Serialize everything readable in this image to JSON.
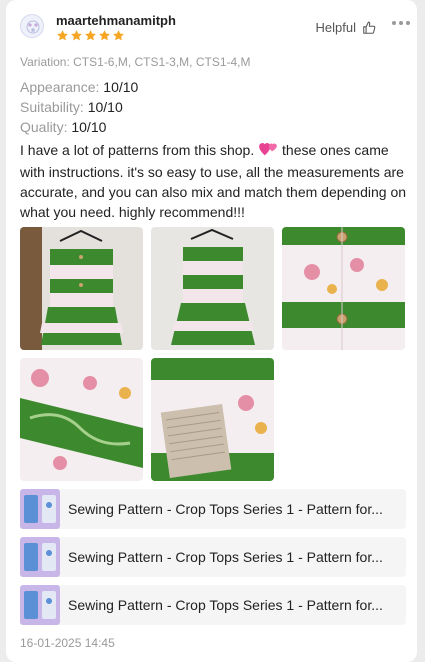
{
  "review": {
    "username": "maartehmanamitph",
    "rating_stars": 5,
    "helpful_label": "Helpful",
    "variation": "Variation: CTS1-6,M, CTS1-3,M, CTS1-4,M",
    "metrics": [
      {
        "name": "Appearance:",
        "value": "10/10"
      },
      {
        "name": "Suitability:",
        "value": "10/10"
      },
      {
        "name": "Quality:",
        "value": "10/10"
      }
    ],
    "text_part1": "I have a lot of patterns from this shop.",
    "text_part2": "these ones came with instructions. it's so easy to use, all the measurements are accurate, and you can also mix and match them depending on what you need. highly recommend!!!",
    "date": "16-01-2025 14:45"
  },
  "photos": [
    {
      "label": "photo-top-hanger-front"
    },
    {
      "label": "photo-top-hanger-back"
    },
    {
      "label": "photo-fabric-closeup-buttons"
    },
    {
      "label": "photo-fabric-closeup-pattern"
    },
    {
      "label": "photo-fabric-with-label"
    }
  ],
  "products": [
    {
      "title": "Sewing Pattern - Crop Tops Series 1 - Pattern for..."
    },
    {
      "title": "Sewing Pattern - Crop Tops Series 1 - Pattern for..."
    },
    {
      "title": "Sewing Pattern - Crop Tops Series 1 - Pattern for..."
    }
  ],
  "colors": {
    "star": "#f5a623",
    "heart": "#e84393",
    "fabric_green": "#3d8a2e",
    "fabric_pink": "#e58fa7"
  }
}
